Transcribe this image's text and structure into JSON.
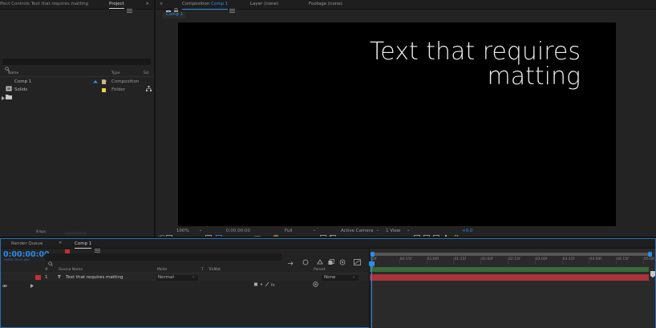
{
  "top_left_tabs": {
    "effect_controls": "ffect Controls  Text that requires matting",
    "project": "Project"
  },
  "project": {
    "search_placeholder": "",
    "col_name": "Name",
    "col_type": "Type",
    "col_size": "Siz",
    "items": [
      {
        "name": "Comp 1",
        "type": "Composition",
        "swatch": "#c9b98a"
      },
      {
        "name": "Solids",
        "type": "Folder",
        "swatch": "#e4d44a"
      }
    ],
    "bpc": "8 bpc"
  },
  "viewer_tabs": {
    "composition_prefix": "Composition",
    "composition_name": "Comp 1",
    "layer": "Layer (none)",
    "footage": "Footage (none)"
  },
  "viewer": {
    "comp_tab": "Comp 1",
    "canvas_text_line1": "Text that requires",
    "canvas_text_line2": "matting",
    "zoom": "100%",
    "timecode": "0:00:00:00",
    "resolution": "Full",
    "camera": "Active Camera",
    "view": "1 View",
    "exposure": "+0.0"
  },
  "timeline_tabs": {
    "render_queue": "Render Queue",
    "comp": "Comp 1"
  },
  "timeline": {
    "current_time": "0:00:00:00",
    "frame_info": "00000 (30.00 fps)",
    "col_num": "#",
    "col_source": "Source Name",
    "col_mode": "Mode",
    "col_t": "T",
    "col_trkmat": "TrkMat",
    "col_parent": "Parent",
    "layer": {
      "index": "1",
      "type_glyph": "T",
      "name": "Text that requires matting",
      "mode": "Normal",
      "parent": "None",
      "label_color": "#c0303a"
    },
    "ruler": [
      "0f",
      "00:15f",
      "01:00f",
      "01:15f",
      "02:00f",
      "02:15f",
      "03:00f",
      "03:15f",
      "04:00f",
      "04:15f",
      "05:00"
    ],
    "accent": "#2d8ceb",
    "layer_bar_color": "#a83338",
    "work_area_color": "#3a6a3a"
  }
}
